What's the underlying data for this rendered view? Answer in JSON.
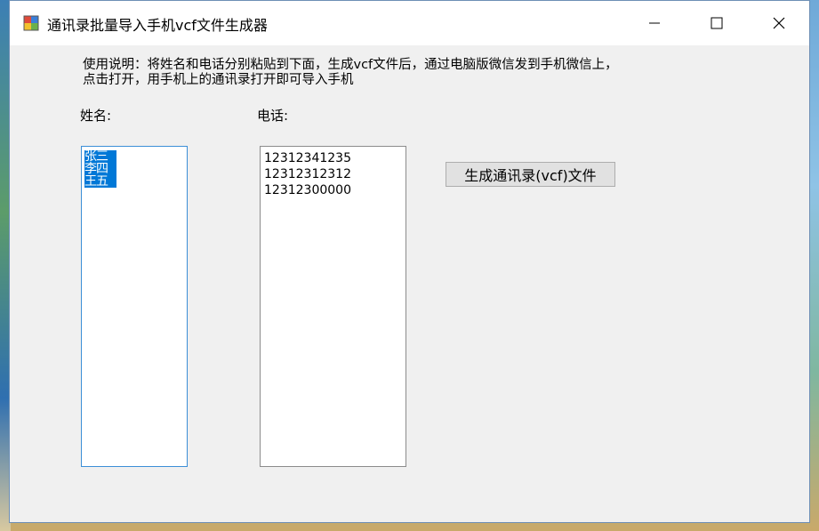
{
  "window": {
    "title": "通讯录批量导入手机vcf文件生成器",
    "controls": {
      "minimize": "—",
      "maximize": "☐",
      "close": "✕"
    }
  },
  "instructions": {
    "line1": "使用说明：将姓名和电话分别粘贴到下面，生成vcf文件后，通过电脑版微信发到手机微信上，",
    "line2": "点击打开，用手机上的通讯录打开即可导入手机"
  },
  "form": {
    "name_label": "姓名:",
    "phone_label": "电话:",
    "names": [
      "张三",
      "李四",
      "王五"
    ],
    "phones": [
      "12312341235",
      "12312312312",
      "12312300000"
    ],
    "generate_button": "生成通讯录(vcf)文件"
  },
  "colors": {
    "selection": "#0078d7",
    "window_bg": "#f0f0f0",
    "button_bg": "#e1e1e1"
  }
}
